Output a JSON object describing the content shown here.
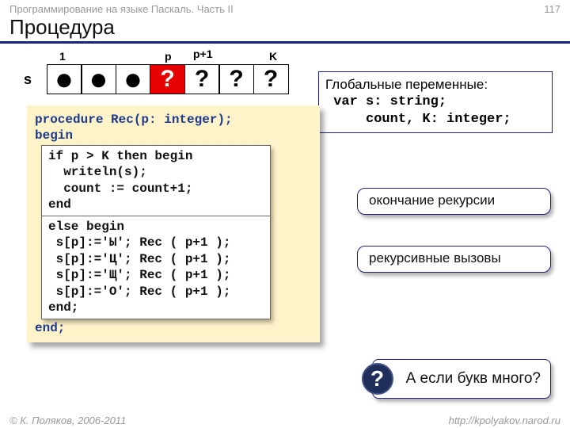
{
  "meta": {
    "course": "Программирование на языке Паскаль. Часть II",
    "page": "117"
  },
  "title": "Процедура",
  "array": {
    "label": "s",
    "headers": {
      "h1": "1",
      "h2": "p",
      "h3": "p+1",
      "h4": "K"
    },
    "cells": [
      "●",
      "●",
      "●",
      "?",
      "?",
      "?",
      "?"
    ]
  },
  "globals": {
    "title": "Глобальные переменные:",
    "l1": " var s: string;",
    "l2": "     count, K: integer;"
  },
  "code": {
    "l1": "procedure Rec(p: integer);",
    "l2": "begin",
    "box1": {
      "l1": "if p > K then begin",
      "l2": "  writeln(s);",
      "l3": "  count := count+1;",
      "l4": "end"
    },
    "box2": {
      "l1": "else begin",
      "l2": " s[p]:='Ы'; Rec ( p+1 );",
      "l3": " s[p]:='Ц'; Rec ( p+1 );",
      "l4": " s[p]:='Щ'; Rec ( p+1 );",
      "l5": " s[p]:='О'; Rec ( p+1 );",
      "l6": "end;"
    },
    "lend": "end;"
  },
  "bubbles": {
    "b1": "окончание рекурсии",
    "b2": "рекурсивные вызовы"
  },
  "question": {
    "icon": "?",
    "text": "А если букв много?"
  },
  "footer": {
    "left": "© К. Поляков, 2006-2011",
    "right": "http://kpolyakov.narod.ru"
  }
}
